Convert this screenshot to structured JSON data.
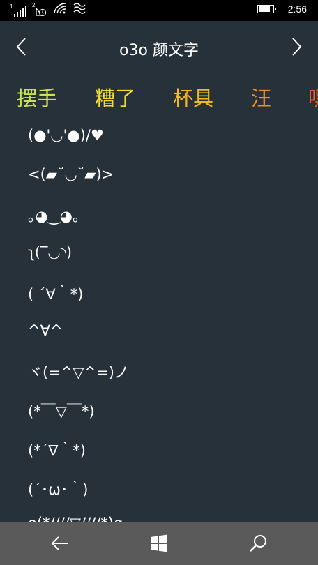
{
  "status_bar": {
    "sim1_label": "1",
    "sim2_label": "2",
    "battery_level": 0.9,
    "time": "2:56"
  },
  "header": {
    "title": "o3o 颜文字",
    "prev_icon": "chevron-left-icon",
    "next_icon": "chevron-right-icon"
  },
  "tabs": [
    {
      "label": "摆手",
      "color": "#c9e24d"
    },
    {
      "label": "糟了",
      "color": "#f3de2e"
    },
    {
      "label": "杯具",
      "color": "#f4b81e"
    },
    {
      "label": "汪",
      "color": "#f39020"
    },
    {
      "label": "嘿",
      "color": "#ef5a2a"
    }
  ],
  "kaomoji": [
    "(●'◡'●)/♥",
    "<(▰˘◡˘▰)>",
    "｡◕‿◕｡",
    "ʅ(‾◡◝)",
    "( ´∀｀*)",
    "^∀^",
    "ヾ(=^▽^=)ノ",
    "(*￣▽￣*)",
    "(*´∇｀*)",
    "(´･ω･｀)",
    "o(*////▽////*)q"
  ],
  "app_bar": {
    "back_icon": "back-arrow-icon",
    "home_icon": "windows-icon",
    "search_icon": "search-icon"
  }
}
